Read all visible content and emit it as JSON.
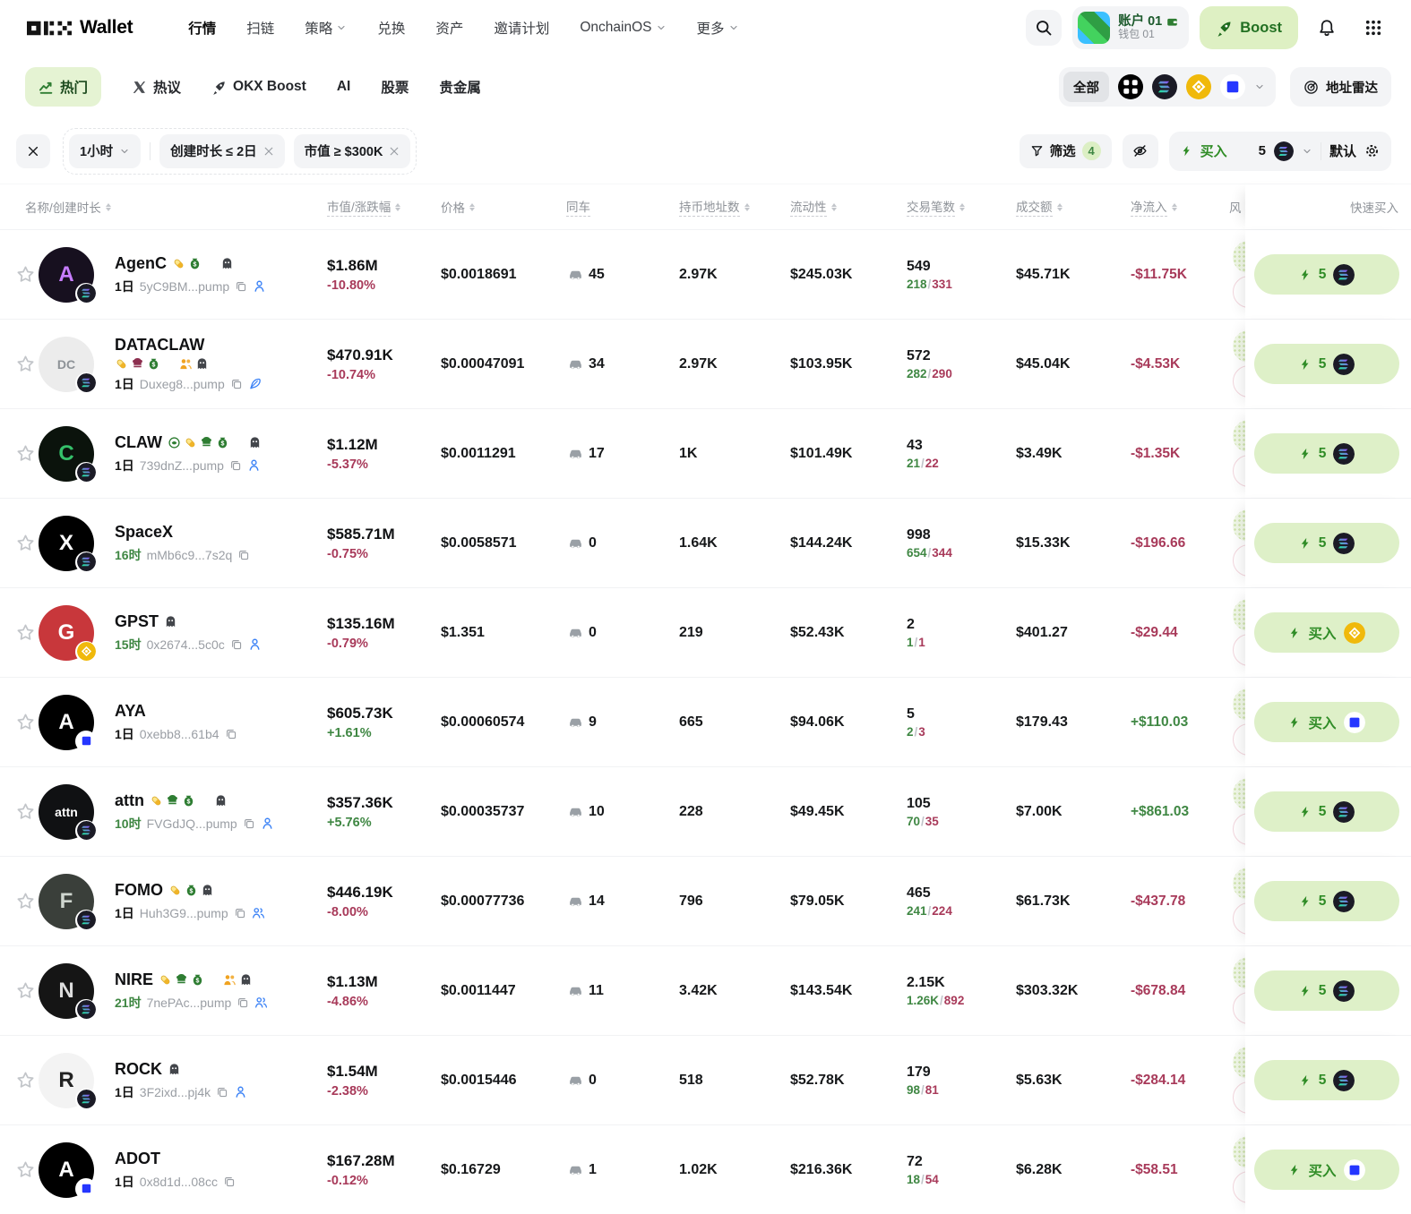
{
  "topnav": {
    "logo_word": "Wallet",
    "items": [
      {
        "label": "行情",
        "active": true,
        "dropdown": false
      },
      {
        "label": "扫链",
        "active": false,
        "dropdown": false
      },
      {
        "label": "策略",
        "active": false,
        "dropdown": true
      },
      {
        "label": "兑换",
        "active": false,
        "dropdown": false
      },
      {
        "label": "资产",
        "active": false,
        "dropdown": false
      },
      {
        "label": "邀请计划",
        "active": false,
        "dropdown": false
      },
      {
        "label": "OnchainOS",
        "active": false,
        "dropdown": true
      },
      {
        "label": "更多",
        "active": false,
        "dropdown": true
      }
    ],
    "account": {
      "name": "账户 01",
      "wallet": "钱包 01"
    },
    "boost_label": "Boost"
  },
  "tabs": [
    {
      "label": "热门"
    },
    {
      "label": "热议"
    },
    {
      "label": "OKX Boost"
    },
    {
      "label": "AI"
    },
    {
      "label": "股票"
    },
    {
      "label": "贵金属"
    }
  ],
  "chain_filter": {
    "all_label": "全部",
    "radar_label": "地址雷达"
  },
  "filters": {
    "time": "1小时",
    "chips": [
      "创建时长 ≤ 2日",
      "市值 ≥ $300K"
    ],
    "filter_label": "筛选",
    "filter_count": "4",
    "buy_label": "买入",
    "buy_amount": "5",
    "default_label": "默认"
  },
  "table": {
    "headers": [
      "名称/创建时长",
      "市值/涨跌幅",
      "价格",
      "同车",
      "持币地址数",
      "流动性",
      "交易笔数",
      "成交额",
      "净流入",
      "风",
      "快速买入"
    ]
  },
  "rows": [
    {
      "name": "AgenC",
      "badges": [
        "pill",
        "bag",
        "bolt-green",
        "ghost"
      ],
      "badges_below": false,
      "age": "1日",
      "age_green": false,
      "address": "5yC9BM...pump",
      "link_icon": "person",
      "chain": "sol",
      "avatar": {
        "text": "A",
        "bg": "#17101f",
        "fg": "#c77dff",
        "small": false
      },
      "mcap": "$1.86M",
      "change": "-10.80%",
      "price": "$0.0018691",
      "seats": "45",
      "holders": "2.97K",
      "liquidity": "$245.03K",
      "tx_total": "549",
      "tx_buys": "218",
      "tx_sells": "331",
      "volume": "$45.71K",
      "netflow": "-$11.75K",
      "buy": {
        "text": "5",
        "chain": "sol"
      }
    },
    {
      "name": "DATACLAW",
      "badges": [
        "pill",
        "hat-red",
        "bag",
        "bolt-red",
        "people",
        "ghost"
      ],
      "badges_below": true,
      "age": "1日",
      "age_green": false,
      "address": "Duxeg8...pump",
      "link_icon": "feather",
      "chain": "sol",
      "avatar": {
        "text": "DC",
        "bg": "#ececec",
        "fg": "#8d9297",
        "small": true
      },
      "mcap": "$470.91K",
      "change": "-10.74%",
      "price": "$0.00047091",
      "seats": "34",
      "holders": "2.97K",
      "liquidity": "$103.95K",
      "tx_total": "572",
      "tx_buys": "282",
      "tx_sells": "290",
      "volume": "$45.04K",
      "netflow": "-$4.53K",
      "buy": {
        "text": "5",
        "chain": "sol"
      }
    },
    {
      "name": "CLAW",
      "badges": [
        "seed",
        "pill",
        "hat-green",
        "bag",
        "bolt-green",
        "ghost"
      ],
      "badges_below": false,
      "age": "1日",
      "age_green": false,
      "address": "739dnZ...pump",
      "link_icon": "person",
      "chain": "sol",
      "avatar": {
        "text": "C",
        "bg": "#0b130c",
        "fg": "#35c06a",
        "small": false
      },
      "mcap": "$1.12M",
      "change": "-5.37%",
      "price": "$0.0011291",
      "seats": "17",
      "holders": "1K",
      "liquidity": "$101.49K",
      "tx_total": "43",
      "tx_buys": "21",
      "tx_sells": "22",
      "volume": "$3.49K",
      "netflow": "-$1.35K",
      "buy": {
        "text": "5",
        "chain": "sol"
      }
    },
    {
      "name": "SpaceX",
      "badges": [],
      "badges_below": false,
      "age": "16时",
      "age_green": true,
      "address": "mMb6c9...7s2q",
      "link_icon": null,
      "chain": "sol",
      "avatar": {
        "text": "X",
        "bg": "#000000",
        "fg": "#ffffff",
        "small": false
      },
      "mcap": "$585.71M",
      "change": "-0.75%",
      "price": "$0.0058571",
      "seats": "0",
      "holders": "1.64K",
      "liquidity": "$144.24K",
      "tx_total": "998",
      "tx_buys": "654",
      "tx_sells": "344",
      "volume": "$15.33K",
      "netflow": "-$196.66",
      "buy": {
        "text": "5",
        "chain": "sol"
      }
    },
    {
      "name": "GPST",
      "badges": [
        "ghost"
      ],
      "badges_below": false,
      "age": "15时",
      "age_green": true,
      "address": "0x2674...5c0c",
      "link_icon": "person",
      "chain": "bnb",
      "avatar": {
        "text": "G",
        "bg": "#c8373b",
        "fg": "#ffffff",
        "small": false
      },
      "mcap": "$135.16M",
      "change": "-0.79%",
      "price": "$1.351",
      "seats": "0",
      "holders": "219",
      "liquidity": "$52.43K",
      "tx_total": "2",
      "tx_buys": "1",
      "tx_sells": "1",
      "volume": "$401.27",
      "netflow": "-$29.44",
      "buy": {
        "text": "买入",
        "chain": "bnb"
      }
    },
    {
      "name": "AYA",
      "badges": [
        "bolt-red"
      ],
      "badges_below": false,
      "age": "1日",
      "age_green": false,
      "address": "0xebb8...61b4",
      "link_icon": null,
      "chain": "base",
      "avatar": {
        "text": "A",
        "bg": "#000000",
        "fg": "#ffffff",
        "small": false
      },
      "mcap": "$605.73K",
      "change": "+1.61%",
      "price": "$0.00060574",
      "seats": "9",
      "holders": "665",
      "liquidity": "$94.06K",
      "tx_total": "5",
      "tx_buys": "2",
      "tx_sells": "3",
      "volume": "$179.43",
      "netflow": "+$110.03",
      "buy": {
        "text": "买入",
        "chain": "base"
      }
    },
    {
      "name": "attn",
      "badges": [
        "pill",
        "hat-green",
        "bag",
        "bolt-red",
        "ghost"
      ],
      "badges_below": false,
      "age": "10时",
      "age_green": true,
      "address": "FVGdJQ...pump",
      "link_icon": "person",
      "chain": "sol",
      "avatar": {
        "text": "attn",
        "bg": "#101113",
        "fg": "#ffffff",
        "small": true
      },
      "mcap": "$357.36K",
      "change": "+5.76%",
      "price": "$0.00035737",
      "seats": "10",
      "holders": "228",
      "liquidity": "$49.45K",
      "tx_total": "105",
      "tx_buys": "70",
      "tx_sells": "35",
      "volume": "$7.00K",
      "netflow": "+$861.03",
      "buy": {
        "text": "5",
        "chain": "sol"
      }
    },
    {
      "name": "FOMO",
      "badges": [
        "pill",
        "bag",
        "ghost"
      ],
      "badges_below": false,
      "age": "1日",
      "age_green": false,
      "address": "Huh3G9...pump",
      "link_icon": "people",
      "chain": "sol",
      "avatar": {
        "text": "F",
        "bg": "#3a3f3a",
        "fg": "#cfd6cf",
        "small": false
      },
      "mcap": "$446.19K",
      "change": "-8.00%",
      "price": "$0.00077736",
      "seats": "14",
      "holders": "796",
      "liquidity": "$79.05K",
      "tx_total": "465",
      "tx_buys": "241",
      "tx_sells": "224",
      "volume": "$61.73K",
      "netflow": "-$437.78",
      "buy": {
        "text": "5",
        "chain": "sol"
      }
    },
    {
      "name": "NIRE",
      "badges": [
        "pill",
        "hat-green",
        "bag",
        "bolt-green",
        "people",
        "ghost"
      ],
      "badges_below": false,
      "age": "21时",
      "age_green": true,
      "address": "7nePAc...pump",
      "link_icon": "people",
      "chain": "sol",
      "avatar": {
        "text": "N",
        "bg": "#151515",
        "fg": "#dddddd",
        "small": false
      },
      "mcap": "$1.13M",
      "change": "-4.86%",
      "price": "$0.0011447",
      "seats": "11",
      "holders": "3.42K",
      "liquidity": "$143.54K",
      "tx_total": "2.15K",
      "tx_buys": "1.26K",
      "tx_sells": "892",
      "volume": "$303.32K",
      "netflow": "-$678.84",
      "buy": {
        "text": "5",
        "chain": "sol"
      }
    },
    {
      "name": "ROCK",
      "badges": [
        "ghost"
      ],
      "badges_below": false,
      "age": "1日",
      "age_green": false,
      "address": "3F2ixd...pj4k",
      "link_icon": "person",
      "chain": "sol",
      "avatar": {
        "text": "R",
        "bg": "#f3f3f3",
        "fg": "#222222",
        "small": false
      },
      "mcap": "$1.54M",
      "change": "-2.38%",
      "price": "$0.0015446",
      "seats": "0",
      "holders": "518",
      "liquidity": "$52.78K",
      "tx_total": "179",
      "tx_buys": "98",
      "tx_sells": "81",
      "volume": "$5.63K",
      "netflow": "-$284.14",
      "buy": {
        "text": "5",
        "chain": "sol"
      }
    },
    {
      "name": "ADOT",
      "badges": [],
      "badges_below": false,
      "age": "1日",
      "age_green": false,
      "address": "0x8d1d...08cc",
      "link_icon": null,
      "chain": "base",
      "avatar": {
        "text": "A",
        "bg": "#000000",
        "fg": "#ffffff",
        "small": false
      },
      "mcap": "$167.28M",
      "change": "-0.12%",
      "price": "$0.16729",
      "seats": "1",
      "holders": "1.02K",
      "liquidity": "$216.36K",
      "tx_total": "72",
      "tx_buys": "18",
      "tx_sells": "54",
      "volume": "$6.28K",
      "netflow": "-$58.51",
      "buy": {
        "text": "买入",
        "chain": "base"
      }
    }
  ],
  "colors": {
    "accent_green": "#2f8c26",
    "negative_red": "#a83a5a",
    "positive_green": "#3f8743",
    "buy_button_bg": "#def0c8",
    "active_tab_bg": "#e5f3d3"
  }
}
